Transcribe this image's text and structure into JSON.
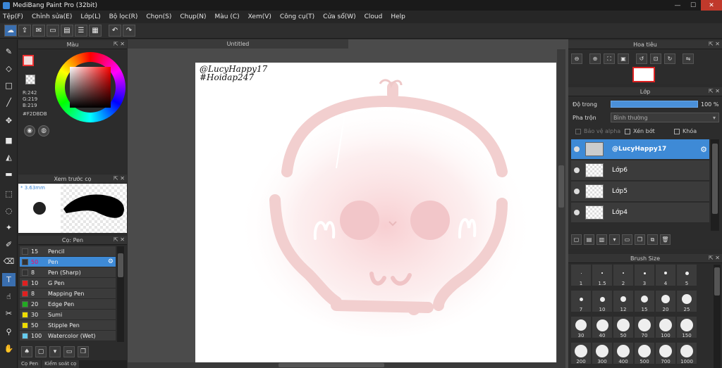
{
  "window": {
    "title": "MediBang Paint Pro (32bit)",
    "controls": [
      "—",
      "☐",
      "✕"
    ]
  },
  "menu": [
    "Tệp(F)",
    "Chỉnh sửa(E)",
    "Lớp(L)",
    "Bộ lọc(R)",
    "Chọn(S)",
    "Chụp(N)",
    "Màu (C)",
    "Xem(V)",
    "Công cụ(T)",
    "Cửa sổ(W)",
    "Cloud",
    "Help"
  ],
  "color_panel": {
    "title": "Màu",
    "r": "R:242",
    "g": "G:219",
    "b": "B:219",
    "hex": "#F2DBDB",
    "current_color": "#F2DBDB"
  },
  "brush_preview": {
    "title": "Xem trước cọ",
    "size": "* 3.63mm"
  },
  "brush_panel": {
    "title": "Cọ: Pen",
    "items": [
      {
        "size": "15",
        "name": "Pencil",
        "color": "#333333"
      },
      {
        "size": "50",
        "name": "Pen",
        "color": "#333333"
      },
      {
        "size": "8",
        "name": "Pen (Sharp)",
        "color": "#333333"
      },
      {
        "size": "10",
        "name": "G Pen",
        "color": "#e02020"
      },
      {
        "size": "8",
        "name": "Mapping Pen",
        "color": "#e02020"
      },
      {
        "size": "20",
        "name": "Edge Pen",
        "color": "#22aa22"
      },
      {
        "size": "30",
        "name": "Sumi",
        "color": "#eedd00"
      },
      {
        "size": "50",
        "name": "Stipple Pen",
        "color": "#eedd00"
      },
      {
        "size": "100",
        "name": "Watercolor (Wet)",
        "color": "#66ccee"
      }
    ],
    "selected_index": 1
  },
  "bottom_tabs": [
    "Cọ Pen",
    "Kiểm soát cọ"
  ],
  "document": {
    "tab": "Untitled",
    "watermark_line1": "@LucyHappy17",
    "watermark_line2": "#Hoidap247"
  },
  "navigator": {
    "title": "Hoa tiêu"
  },
  "layer_panel": {
    "title": "Lớp",
    "opacity_label": "Độ trong",
    "opacity_value": "100 %",
    "opacity_fraction": 1.0,
    "blend_label": "Pha trộn",
    "blend_value": "Bình thường",
    "protect_alpha": "Bảo vệ alpha",
    "clipping": "Xén bớt",
    "lock": "Khóa",
    "layers": [
      {
        "name": "@LucyHappy17",
        "selected": true
      },
      {
        "name": "Lớp6",
        "selected": false
      },
      {
        "name": "Lớp5",
        "selected": false
      },
      {
        "name": "Lớp4",
        "selected": false
      }
    ]
  },
  "brush_size": {
    "title": "Brush Size",
    "sizes": [
      "1",
      "1.5",
      "2",
      "3",
      "4",
      "5",
      "7",
      "10",
      "12",
      "15",
      "20",
      "25",
      "30",
      "40",
      "50",
      "70",
      "100",
      "150",
      "200",
      "300",
      "400",
      "500",
      "700",
      "1000"
    ]
  },
  "colors": {
    "accent": "#3e8ad6",
    "artwork": "#f2dbdb"
  }
}
